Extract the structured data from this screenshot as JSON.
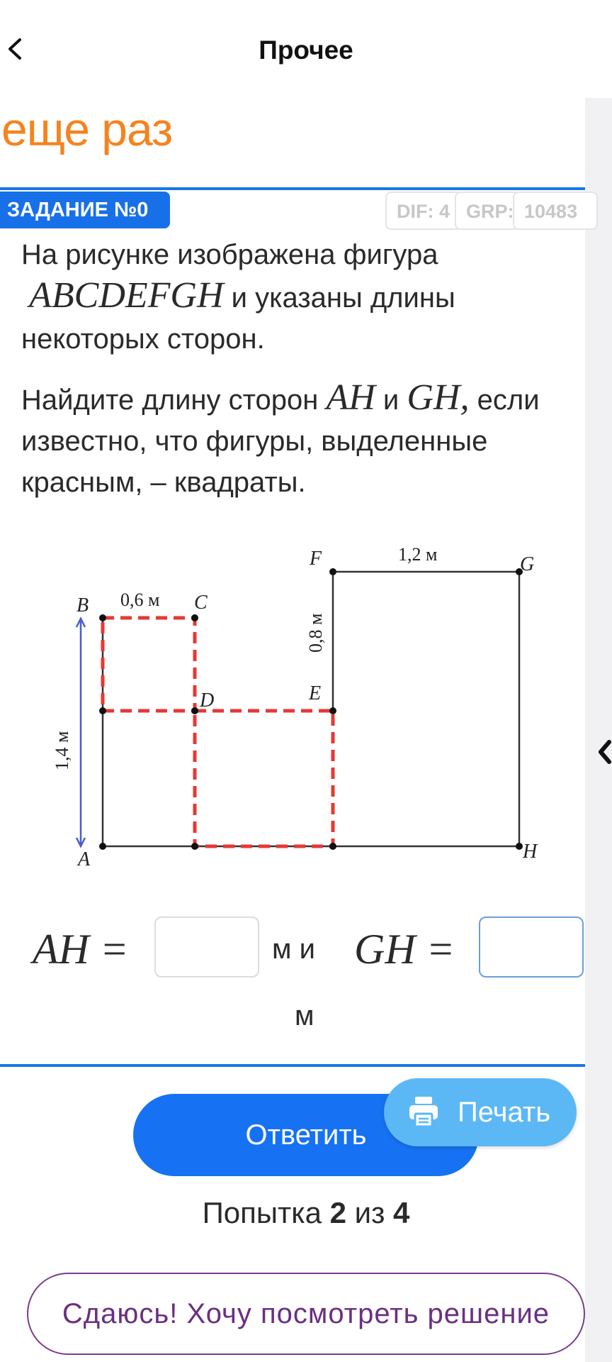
{
  "header": {
    "title": "Прочее"
  },
  "heading": "еще раз",
  "task": {
    "badge": "ЗАДАНИЕ №0",
    "tags": {
      "dif": "DIF: 4",
      "grp": "GRP: 1",
      "id": "10483"
    },
    "p1_before": "На рисунке изображена фигура",
    "p1_math": "ABCDEFGH",
    "p1_after": "и указаны длины некоторых сторон.",
    "p2_before": "Найдите длину сторон",
    "p2_math1": "AH",
    "p2_and": "и",
    "p2_math2": "GH,",
    "p2_after": "если известно, что фигуры, выделенные красным, – квадраты."
  },
  "figure": {
    "points": {
      "A": "A",
      "B": "B",
      "C": "C",
      "D": "D",
      "E": "E",
      "F": "F",
      "G": "G",
      "H": "H"
    },
    "len_bc": "0,6 м",
    "len_fg": "1,2 м",
    "len_fe": "0,8 м",
    "len_ab": "1,4 м",
    "colors": {
      "square_outline": "#e53935",
      "arrow": "#4a5bd1",
      "line": "#333333"
    }
  },
  "answer": {
    "lhs1": "AH =",
    "unit_and": "м и",
    "lhs2": "GH =",
    "unit2": "м",
    "value1": "",
    "value2": ""
  },
  "buttons": {
    "submit": "Ответить",
    "print": "Печать",
    "giveup": "Сдаюсь! Хочу посмотреть решение"
  },
  "attempt": {
    "prefix": "Попытка",
    "current": "2",
    "mid": "из",
    "total": "4"
  },
  "accent": {
    "orange": "#f5831f",
    "blue": "#1672f2",
    "purple": "#6b2f82",
    "print": "#5bb8f5"
  }
}
